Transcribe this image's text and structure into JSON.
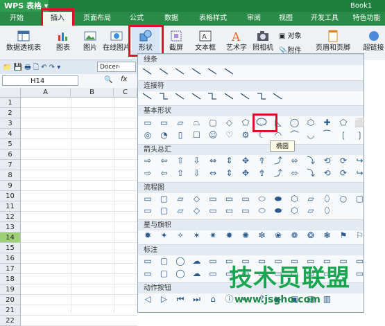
{
  "title_bar": {
    "app_name": "WPS 表格",
    "doc_name": "Book1"
  },
  "menu": {
    "tabs": [
      "开始",
      "插入",
      "页面布局",
      "公式",
      "数据",
      "表格样式",
      "审阅",
      "视图",
      "开发工具",
      "特色功能"
    ]
  },
  "ribbon": {
    "buttons": [
      "数据透视表",
      "图表",
      "图片",
      "在线图片",
      "形状",
      "截屏",
      "文本框",
      "艺术字",
      "照相机",
      "页眉和页脚",
      "超链接"
    ],
    "small": [
      "对象",
      "附件"
    ]
  },
  "formula_bar": {
    "name_box": "H14",
    "fx": "fx"
  },
  "quick_access": {
    "docer_label": "Docer-"
  },
  "grid": {
    "columns": [
      "A",
      "B",
      "C"
    ],
    "rows": [
      "1",
      "2",
      "3",
      "4",
      "5",
      "6",
      "7",
      "8",
      "9",
      "10",
      "11",
      "12",
      "13",
      "14",
      "15",
      "16",
      "17",
      "18",
      "19",
      "20",
      "21",
      "22"
    ],
    "selected_row": "14"
  },
  "shapes_panel": {
    "sections": [
      "线条",
      "连接符",
      "基本形状",
      "箭头总汇",
      "流程图",
      "星与旗帜",
      "标注",
      "动作按钮"
    ],
    "tooltip": "椭圆"
  },
  "watermark": {
    "text": "技术员联盟",
    "url": "www.jsgho.com"
  },
  "colors": {
    "accent": "#1d7e3d",
    "highlight": "#e0102a",
    "selected_row": "#9ed07a"
  }
}
